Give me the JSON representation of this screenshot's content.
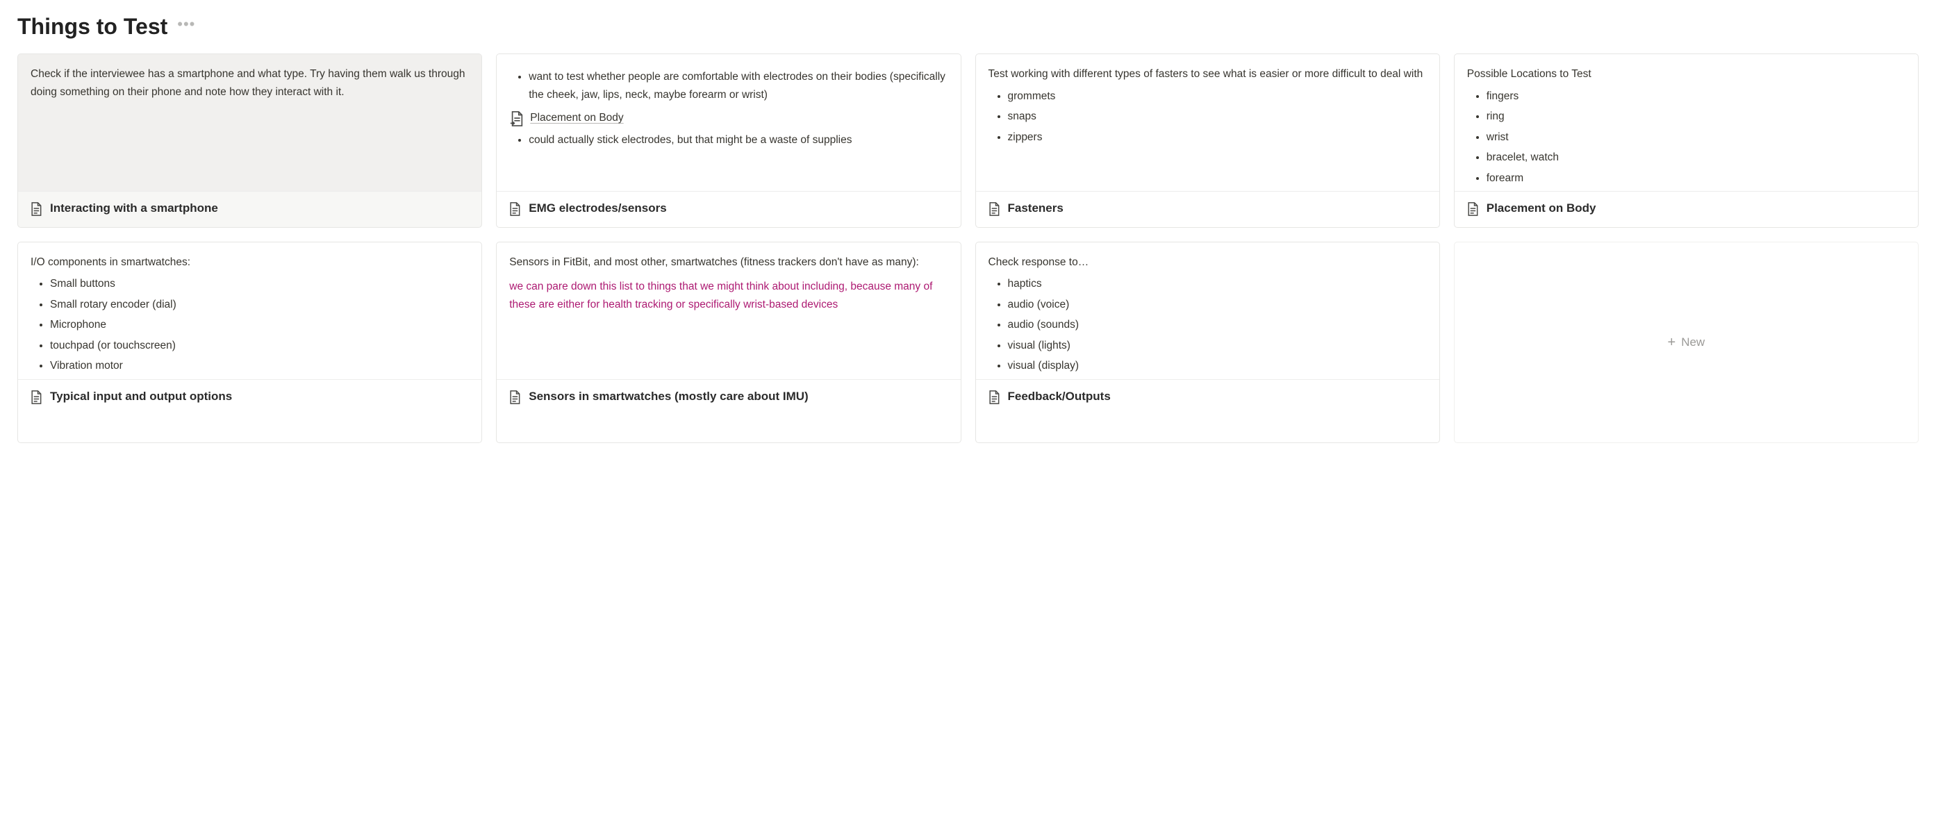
{
  "header": {
    "title": "Things to Test"
  },
  "cards": [
    {
      "name": "interacting-smartphone",
      "hovered": true,
      "title": "Interacting with a smartphone",
      "preview": {
        "intro": "Check if the interviewee has a smartphone and what type. Try having them walk us through doing something on their phone and note how they interact with it."
      }
    },
    {
      "name": "emg-electrodes",
      "hovered": false,
      "title": "EMG electrodes/sensors",
      "preview": {
        "lead_bullets": [
          "want to test whether people are comfortable with electrodes on their bodies (specifically the cheek, jaw, lips, neck, maybe forearm or wrist)"
        ],
        "sublink": "Placement on Body",
        "trail_bullets": [
          "could actually stick electrodes, but that might be a waste of supplies"
        ]
      }
    },
    {
      "name": "fasteners",
      "hovered": false,
      "title": "Fasteners",
      "preview": {
        "intro": "Test working with different types of fasters to see what is easier or more difficult to deal with",
        "bullets": [
          "grommets",
          "snaps",
          "zippers"
        ]
      }
    },
    {
      "name": "placement-on-body",
      "hovered": false,
      "title": "Placement on Body",
      "preview": {
        "intro": "Possible Locations to Test",
        "bullets": [
          "fingers",
          "ring",
          "wrist",
          "bracelet, watch",
          "forearm"
        ]
      }
    },
    {
      "name": "typical-io",
      "hovered": false,
      "title": "Typical input and output options",
      "preview": {
        "intro": "I/O components in smartwatches:",
        "bullets": [
          "Small buttons",
          "Small rotary encoder (dial)",
          "Microphone",
          "touchpad (or touchscreen)",
          "Vibration motor"
        ]
      }
    },
    {
      "name": "sensors-smartwatches",
      "hovered": false,
      "title": "Sensors in smartwatches (mostly care about IMU)",
      "preview": {
        "intro": "Sensors in FitBit, and most other, smartwatches (fitness trackers don't have as many):",
        "note": "we can pare down this list to things that we might think about including, because many of these are either for health tracking or specifically wrist-based devices"
      }
    },
    {
      "name": "feedback-outputs",
      "hovered": false,
      "title": "Feedback/Outputs",
      "preview": {
        "intro": "Check response to…",
        "bullets": [
          "haptics",
          "audio (voice)",
          "audio (sounds)",
          "visual (lights)",
          "visual (display)"
        ]
      }
    }
  ],
  "new_card": {
    "label": "New"
  }
}
